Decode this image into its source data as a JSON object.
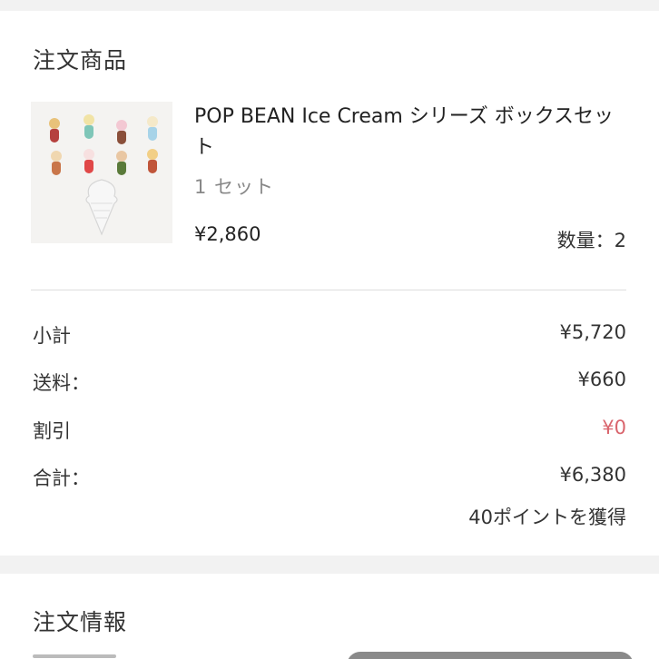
{
  "order_items": {
    "title": "注文商品",
    "product": {
      "name": "POP BEAN Ice Cream シリーズ ボックスセット",
      "variant": "1 セット",
      "price": "¥2,860",
      "quantity": "数量：2"
    }
  },
  "summary": {
    "subtotal_label": "小計",
    "subtotal_value": "¥5,720",
    "shipping_label": "送料：",
    "shipping_value": "¥660",
    "discount_label": "割引",
    "discount_value": "¥0",
    "total_label": "合計：",
    "total_value": "¥6,380",
    "points": "40ポイントを獲得"
  },
  "order_info": {
    "title": "注文情報"
  },
  "colors": {
    "background": "#f2f2f2",
    "card": "#ffffff",
    "discount_red": "#d9646c",
    "muted_text": "#888888"
  }
}
